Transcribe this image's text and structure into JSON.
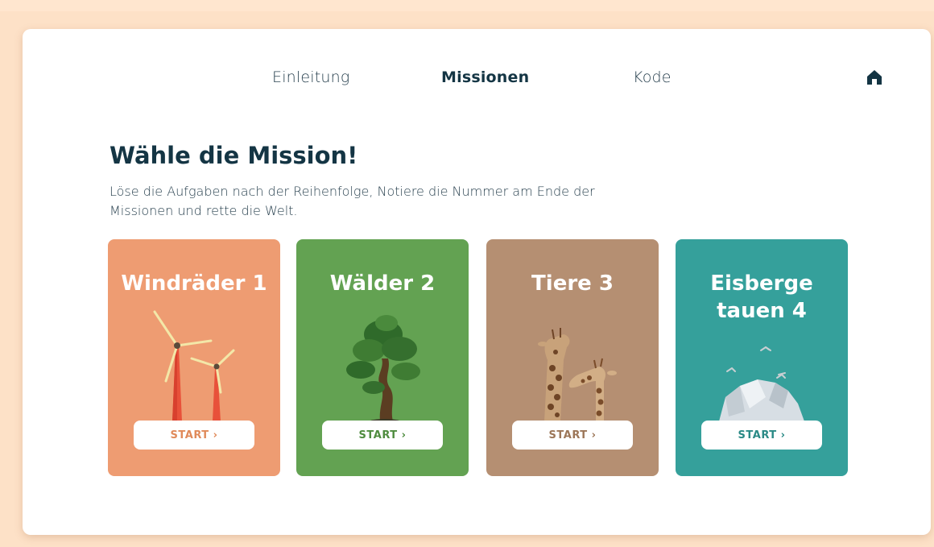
{
  "nav": {
    "items": [
      {
        "label": "Einleitung",
        "active": false
      },
      {
        "label": "Missionen",
        "active": true
      },
      {
        "label": "Kode",
        "active": false
      }
    ],
    "home_icon": "home-icon"
  },
  "heading": "Wähle die Mission!",
  "intro": "Löse die Aufgaben nach der Reihenfolge, Notiere die Nummer am Ende der Missionen und rette die Welt.",
  "missions": [
    {
      "title": "Windräder 1",
      "start_label": "START",
      "chevron": "›",
      "color": "#ee9c72",
      "button_text_color": "#e08a5a",
      "illustration": "wind-turbine-icon"
    },
    {
      "title": "Wälder 2",
      "start_label": "START",
      "chevron": "›",
      "color": "#63a252",
      "button_text_color": "#4f8c3f",
      "illustration": "tree-icon"
    },
    {
      "title": "Tiere 3",
      "start_label": "START",
      "chevron": "›",
      "color": "#b58f72",
      "button_text_color": "#9c7658",
      "illustration": "giraffe-icon"
    },
    {
      "title": "Eisberge tauen 4",
      "start_label": "START",
      "chevron": "›",
      "color": "#35a09b",
      "button_text_color": "#2a8a86",
      "illustration": "iceberg-icon"
    }
  ]
}
